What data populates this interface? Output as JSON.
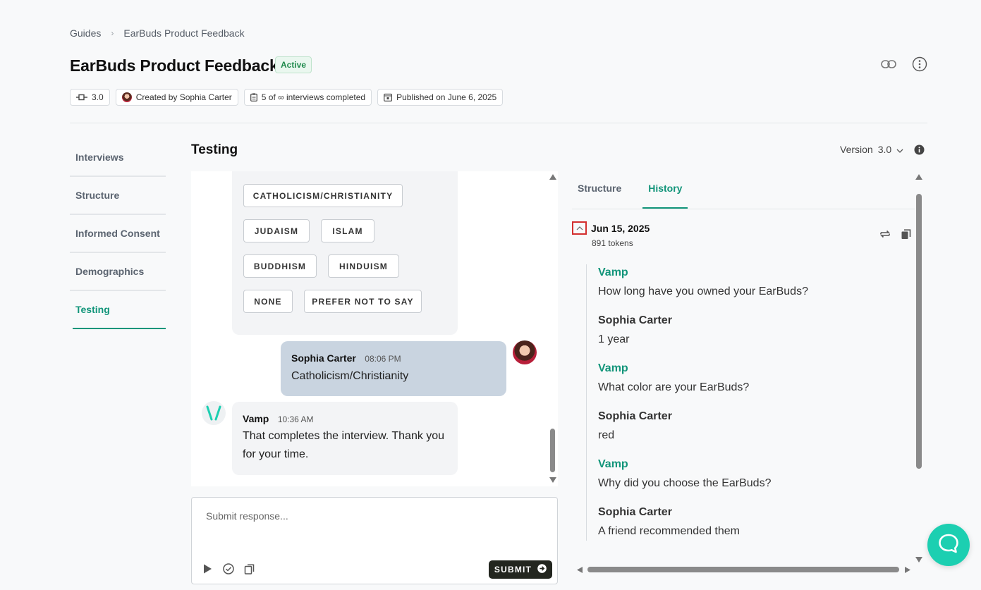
{
  "breadcrumb": {
    "root": "Guides",
    "current": "EarBuds Product Feedback"
  },
  "guide": {
    "title": "EarBuds Product Feedback",
    "status": "Active"
  },
  "meta": {
    "version": "3.0",
    "created_by": "Created by Sophia Carter",
    "interviews": "5 of ∞ interviews completed",
    "published": "Published on June 6, 2025"
  },
  "sidenav": {
    "items": [
      {
        "label": "Interviews"
      },
      {
        "label": "Structure"
      },
      {
        "label": "Informed Consent"
      },
      {
        "label": "Demographics"
      },
      {
        "label": "Testing"
      }
    ],
    "active": "Testing"
  },
  "testing": {
    "title": "Testing",
    "version_label": "Version",
    "version_value": "3.0"
  },
  "chat": {
    "options": [
      "CATHOLICISM/CHRISTIANITY",
      "JUDAISM",
      "ISLAM",
      "BUDDHISM",
      "HINDUISM",
      "NONE",
      "PREFER NOT TO SAY"
    ],
    "user_message": {
      "sender": "Sophia Carter",
      "time": "08:06 PM",
      "text": "Catholicism/Christianity"
    },
    "bot_message": {
      "sender": "Vamp",
      "time": "10:36 AM",
      "text": "That completes the interview. Thank you for your time."
    }
  },
  "composer": {
    "placeholder": "Submit response...",
    "submit_label": "SUBMIT"
  },
  "panel": {
    "tabs": [
      "Structure",
      "History"
    ],
    "active_tab": "History",
    "history": {
      "date": "Jun 15, 2025",
      "tokens": "891 tokens",
      "turns": [
        {
          "speaker": "Vamp",
          "text": "How long have you owned your EarBuds?"
        },
        {
          "speaker": "Sophia Carter",
          "text": "1 year"
        },
        {
          "speaker": "Vamp",
          "text": "What color are your EarBuds?"
        },
        {
          "speaker": "Sophia Carter",
          "text": "red"
        },
        {
          "speaker": "Vamp",
          "text": "Why did you choose the EarBuds?"
        },
        {
          "speaker": "Sophia Carter",
          "text": "A friend recommended them"
        }
      ]
    }
  },
  "colors": {
    "accent": "#12957a",
    "active_badge": "#1f8a4c",
    "support_button": "#1ccfb1",
    "submit_button": "#23261f"
  }
}
